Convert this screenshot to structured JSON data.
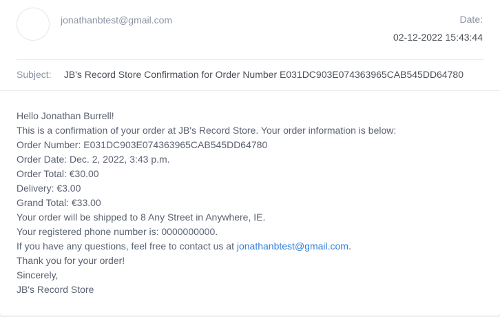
{
  "header": {
    "from_email": "jonathanbtest@gmail.com",
    "date_label": "Date:",
    "date_value": "02-12-2022 15:43:44"
  },
  "subject": {
    "label": "Subject:",
    "text": "JB's Record Store Confirmation for Order Number E031DC903E074363965CAB545DD64780"
  },
  "body": {
    "greeting": "Hello Jonathan Burrell!",
    "intro": "This is a confirmation of your order at JB's Record Store. Your order information is below:",
    "order_number": "Order Number: E031DC903E074363965CAB545DD64780",
    "order_date": "Order Date: Dec. 2, 2022, 3:43 p.m.",
    "order_total": "Order Total: €30.00",
    "delivery": "Delivery: €3.00",
    "grand_total": "Grand Total: €33.00",
    "shipping": "Your order will be shipped to 8 Any Street in Anywhere, IE.",
    "phone": "Your registered phone number is: 0000000000.",
    "contact_prefix": "If you have any questions, feel free to contact us at ",
    "contact_email": "jonathanbtest@gmail.com",
    "contact_suffix": ".",
    "thanks": "Thank you for your order!",
    "signoff": "Sincerely,",
    "signature": "JB's Record Store"
  },
  "colors": {
    "link": "#2f7fd8",
    "muted": "#8a93a3",
    "text": "#5a6170"
  }
}
